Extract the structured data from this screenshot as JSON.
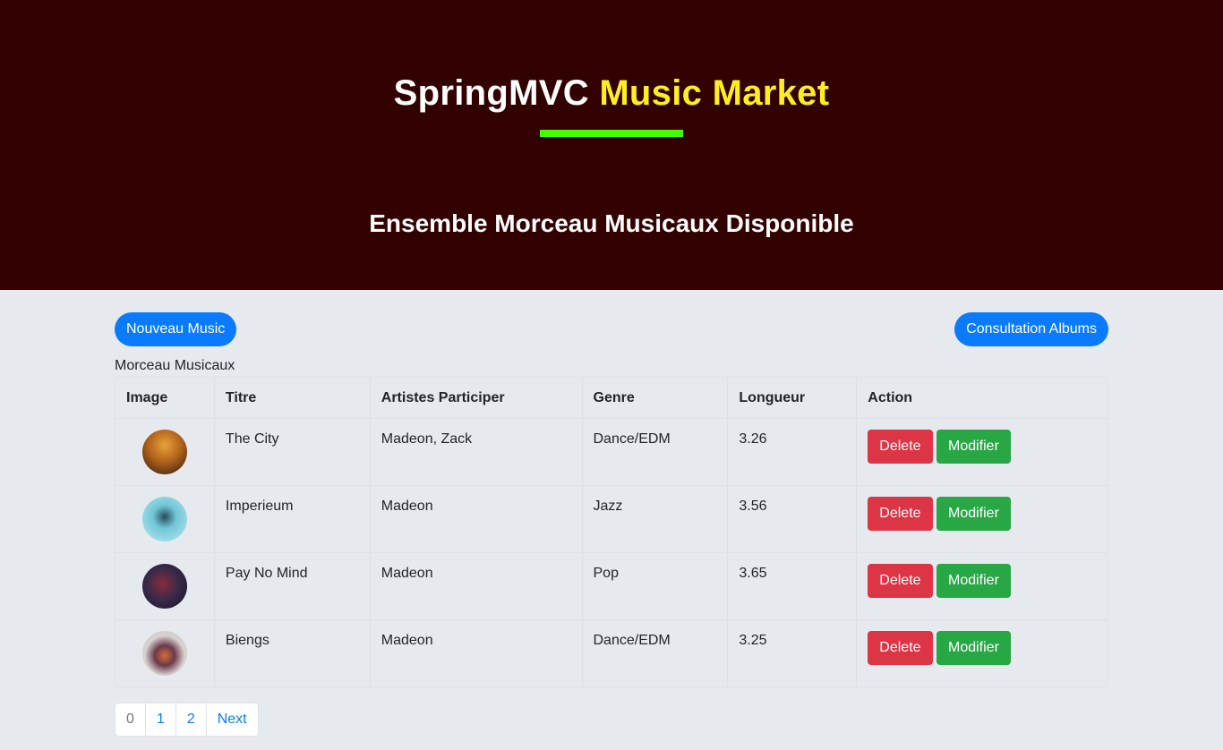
{
  "colors": {
    "header_bg": "#330000",
    "title_white": "#ffffff",
    "title_yellow": "#ffee22",
    "accent_bar": "#44ff00",
    "primary": "#0a7bff",
    "danger": "#dc3545",
    "success": "#28a745",
    "page_active": "#6c757d",
    "page_link": "#0a7bff"
  },
  "header": {
    "title_part1": "SpringMVC",
    "title_part2": "Music Market",
    "subtitle": "Ensemble Morceau Musicaux Disponible"
  },
  "toolbar": {
    "new_label": "Nouveau Music",
    "albums_label": "Consultation Albums"
  },
  "table": {
    "caption": "Morceau Musicaux",
    "headers": [
      "Image",
      "Titre",
      "Artistes Participer",
      "Genre",
      "Longueur",
      "Action"
    ],
    "delete_label": "Delete",
    "edit_label": "Modifier",
    "rows": [
      {
        "title": "The City",
        "artists": "Madeon, Zack",
        "genre": "Dance/EDM",
        "length": "3.26",
        "thumb": "album-cover-orange"
      },
      {
        "title": "Imperieum",
        "artists": "Madeon",
        "genre": "Jazz",
        "length": "3.56",
        "thumb": "album-cover-cyan"
      },
      {
        "title": "Pay No Mind",
        "artists": "Madeon",
        "genre": "Pop",
        "length": "3.65",
        "thumb": "album-cover-dark"
      },
      {
        "title": "Biengs",
        "artists": "Madeon",
        "genre": "Dance/EDM",
        "length": "3.25",
        "thumb": "album-cover-sunset"
      }
    ]
  },
  "pagination": {
    "pages": [
      "0",
      "1",
      "2"
    ],
    "next_label": "Next",
    "active_index": 0
  }
}
